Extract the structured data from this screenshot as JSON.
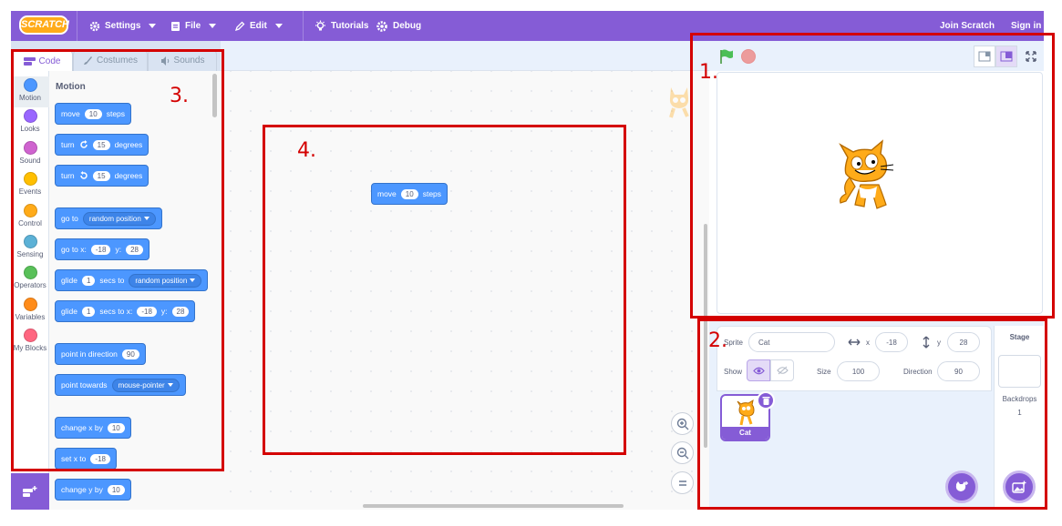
{
  "menubar": {
    "logo": "SCRATCH",
    "settings": "Settings",
    "file": "File",
    "edit": "Edit",
    "tutorials": "Tutorials",
    "debug": "Debug",
    "join": "Join Scratch",
    "signin": "Sign in"
  },
  "tabs": {
    "code": "Code",
    "costumes": "Costumes",
    "sounds": "Sounds"
  },
  "categories": [
    {
      "label": "Motion",
      "color": "#4c97ff"
    },
    {
      "label": "Looks",
      "color": "#9966ff"
    },
    {
      "label": "Sound",
      "color": "#cf63cf"
    },
    {
      "label": "Events",
      "color": "#ffbf00"
    },
    {
      "label": "Control",
      "color": "#ffab19"
    },
    {
      "label": "Sensing",
      "color": "#5cb1d6"
    },
    {
      "label": "Operators",
      "color": "#59c059"
    },
    {
      "label": "Variables",
      "color": "#ff8c1a"
    },
    {
      "label": "My Blocks",
      "color": "#ff6680"
    }
  ],
  "palette": {
    "title": "Motion",
    "move": {
      "a": "move",
      "n": "10",
      "b": "steps"
    },
    "turn_right": {
      "a": "turn",
      "n": "15",
      "b": "degrees"
    },
    "turn_left": {
      "a": "turn",
      "n": "15",
      "b": "degrees"
    },
    "goto": {
      "a": "go to",
      "dd": "random position"
    },
    "gotoxy": {
      "a": "go to x:",
      "x": "-18",
      "b": "y:",
      "y": "28"
    },
    "glide_to": {
      "a": "glide",
      "n": "1",
      "b": "secs to",
      "dd": "random position"
    },
    "glide_xy": {
      "a": "glide",
      "n": "1",
      "b": "secs to x:",
      "x": "-18",
      "c": "y:",
      "y": "28"
    },
    "point_dir": {
      "a": "point in direction",
      "n": "90"
    },
    "point_towards": {
      "a": "point towards",
      "dd": "mouse-pointer"
    },
    "change_x": {
      "a": "change x by",
      "n": "10"
    },
    "set_x": {
      "a": "set x to",
      "n": "-18"
    },
    "change_y": {
      "a": "change y by",
      "n": "10"
    }
  },
  "script": {
    "move": {
      "a": "move",
      "n": "10",
      "b": "steps"
    }
  },
  "sprite_info": {
    "sprite_label": "Sprite",
    "sprite_name": "Cat",
    "x_label": "x",
    "x": "-18",
    "y_label": "y",
    "y": "28",
    "show_label": "Show",
    "size_label": "Size",
    "size": "100",
    "direction_label": "Direction",
    "direction": "90"
  },
  "sprite_list": [
    {
      "name": "Cat"
    }
  ],
  "stage_col": {
    "title": "Stage",
    "backdrops_label": "Backdrops",
    "backdrops_count": "1"
  },
  "callouts": {
    "one": "1.",
    "two": "2.",
    "three": "3.",
    "four": "4."
  },
  "colors": {
    "accent": "#855cd6",
    "motion": "#4c97ff",
    "annotation": "#d40000"
  }
}
